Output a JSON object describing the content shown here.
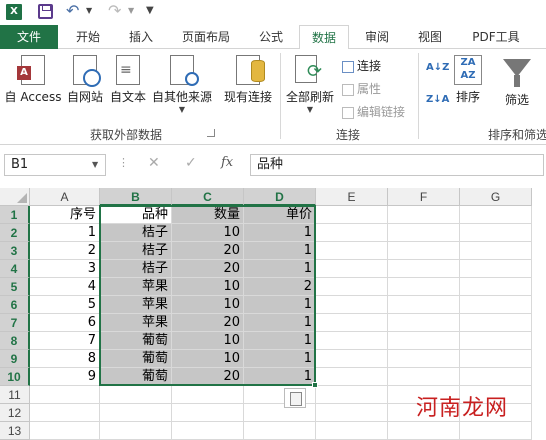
{
  "app": {
    "logo": "X",
    "quick_access_icons": [
      "excel-logo-icon",
      "save-icon",
      "undo-icon",
      "redo-icon",
      "customize-icon"
    ]
  },
  "tabs": [
    "文件",
    "开始",
    "插入",
    "页面布局",
    "公式",
    "数据",
    "审阅",
    "视图",
    "PDF工具"
  ],
  "active_tab": "数据",
  "ribbon": {
    "get_external": {
      "group_label": "获取外部数据",
      "buttons": [
        "自 Access",
        "自网站",
        "自文本",
        "自其他来源"
      ]
    },
    "existing_connections": "现有连接",
    "connections": {
      "group_label": "连接",
      "refresh_all": "全部刷新",
      "connections_btn": "连接",
      "properties_btn": "属性",
      "edit_links_btn": "编辑链接"
    },
    "sort_filter": {
      "group_label": "排序和筛选",
      "sort": "排序",
      "filter": "筛选",
      "az": "A↓Z",
      "za": "Z↓A"
    }
  },
  "formula_bar": {
    "name_box": "B1",
    "fx": "fx",
    "value": "品种"
  },
  "grid": {
    "columns": [
      "A",
      "B",
      "C",
      "D",
      "E",
      "F",
      "G"
    ],
    "selected_columns": [
      "B",
      "C",
      "D"
    ],
    "row_numbers": [
      "1",
      "2",
      "3",
      "4",
      "5",
      "6",
      "7",
      "8",
      "9",
      "10",
      "11",
      "12",
      "13"
    ],
    "header": [
      "序号",
      "品种",
      "数量",
      "单价"
    ],
    "rows": [
      [
        "1",
        "桔子",
        "10",
        "1"
      ],
      [
        "2",
        "桔子",
        "20",
        "1"
      ],
      [
        "3",
        "桔子",
        "20",
        "1"
      ],
      [
        "4",
        "苹果",
        "10",
        "2"
      ],
      [
        "5",
        "苹果",
        "10",
        "1"
      ],
      [
        "6",
        "苹果",
        "20",
        "1"
      ],
      [
        "7",
        "葡萄",
        "10",
        "1"
      ],
      [
        "8",
        "葡萄",
        "10",
        "1"
      ],
      [
        "9",
        "葡萄",
        "20",
        "1"
      ]
    ]
  },
  "watermark": "河南龙网",
  "colors": {
    "accent": "#217346",
    "selection": "#c6c6c6"
  }
}
